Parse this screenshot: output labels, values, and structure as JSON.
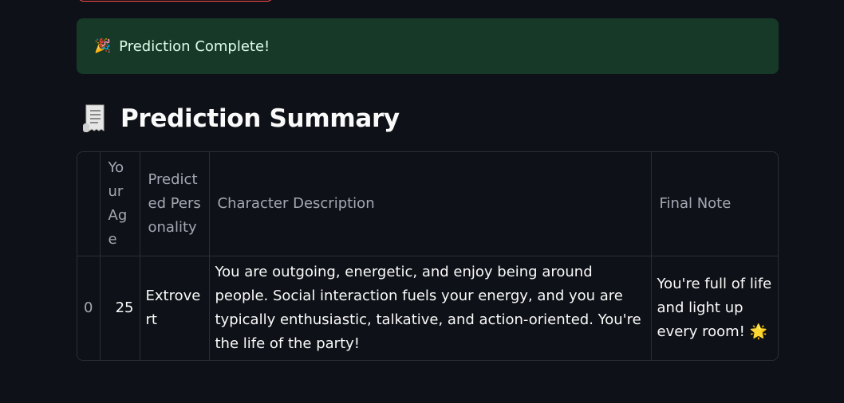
{
  "alert": {
    "icon": "🎉",
    "icon_name": "party-popper-icon",
    "text": "Prediction Complete!",
    "bg_color": "#173928",
    "text_color": "#dffde9"
  },
  "summary": {
    "title": "Prediction Summary",
    "icon_name": "receipt-icon"
  },
  "table": {
    "headers": {
      "index": "",
      "age": "Your Age",
      "personality": "Predicted Personality",
      "description": "Character Description",
      "note": "Final Note"
    },
    "rows": [
      {
        "index": "0",
        "age": "25",
        "personality": "Extrovert",
        "description": "You are outgoing, energetic, and enjoy being around people. Social interaction fuels your energy, and you are typically enthusiastic, talkative, and action-oriented. You're the life of the party!",
        "note": "You're full of life and light up every room! 🌟"
      }
    ]
  },
  "colors": {
    "background": "#0e1117",
    "accent": "#ff4b4b"
  }
}
